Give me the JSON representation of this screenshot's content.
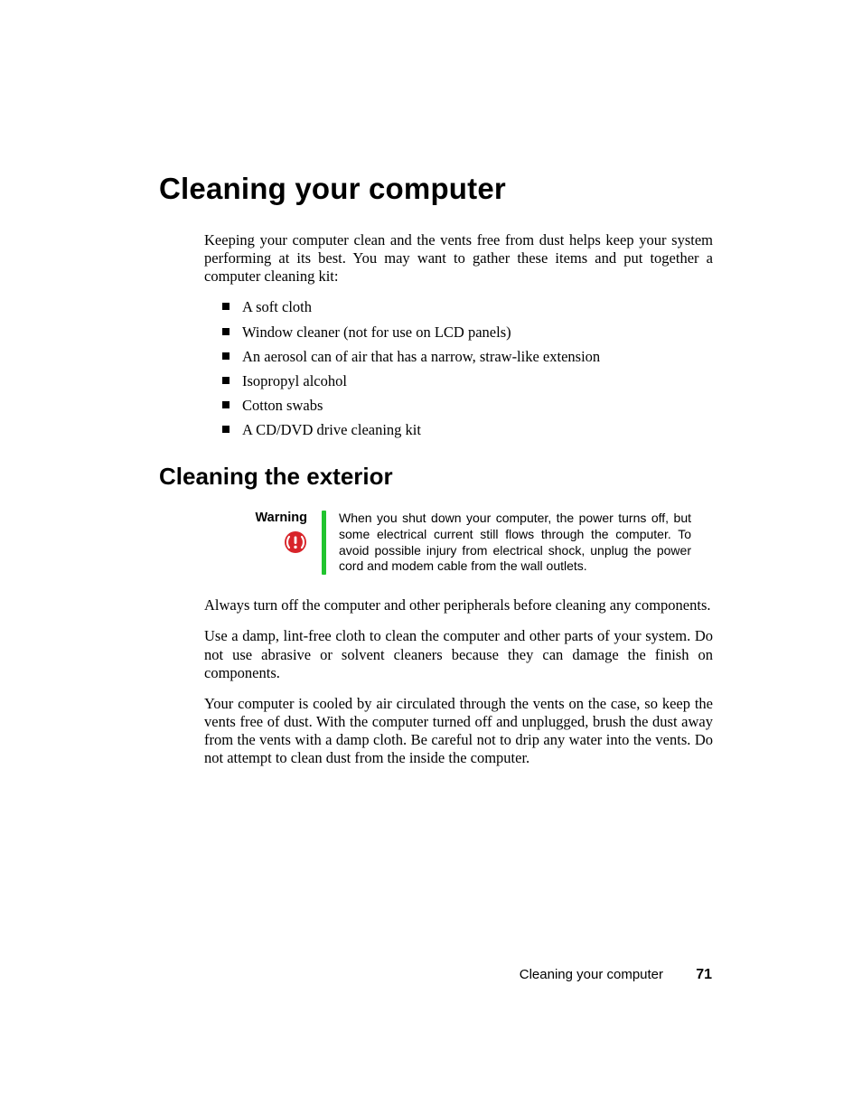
{
  "title": "Cleaning your computer",
  "intro": "Keeping your computer clean and the vents free from dust helps keep your system performing at its best. You may want to gather these items and put together a computer cleaning kit:",
  "bullets": [
    "A soft cloth",
    "Window cleaner (not for use on LCD panels)",
    "An aerosol can of air that has a narrow, straw-like extension",
    "Isopropyl alcohol",
    "Cotton swabs",
    "A CD/DVD drive cleaning kit"
  ],
  "subtitle": "Cleaning the exterior",
  "callout": {
    "label": "Warning",
    "body": "When you shut down your computer, the power turns off, but some electrical current still flows through the computer. To avoid possible injury from electrical shock, unplug the power cord and modem cable from the wall outlets."
  },
  "paragraphs": [
    "Always turn off the computer and other peripherals before cleaning any components.",
    "Use a damp, lint-free cloth to clean the computer and other parts of your system. Do not use abrasive or solvent cleaners because they can damage the finish on components.",
    "Your computer is cooled by air circulated through the vents on the case, so keep the vents free of dust. With the computer turned off and unplugged, brush the dust away from the vents with a damp cloth. Be careful not to drip any water into the vents. Do not attempt to clean dust from the inside the computer."
  ],
  "footer": {
    "section": "Cleaning your computer",
    "page": "71"
  }
}
